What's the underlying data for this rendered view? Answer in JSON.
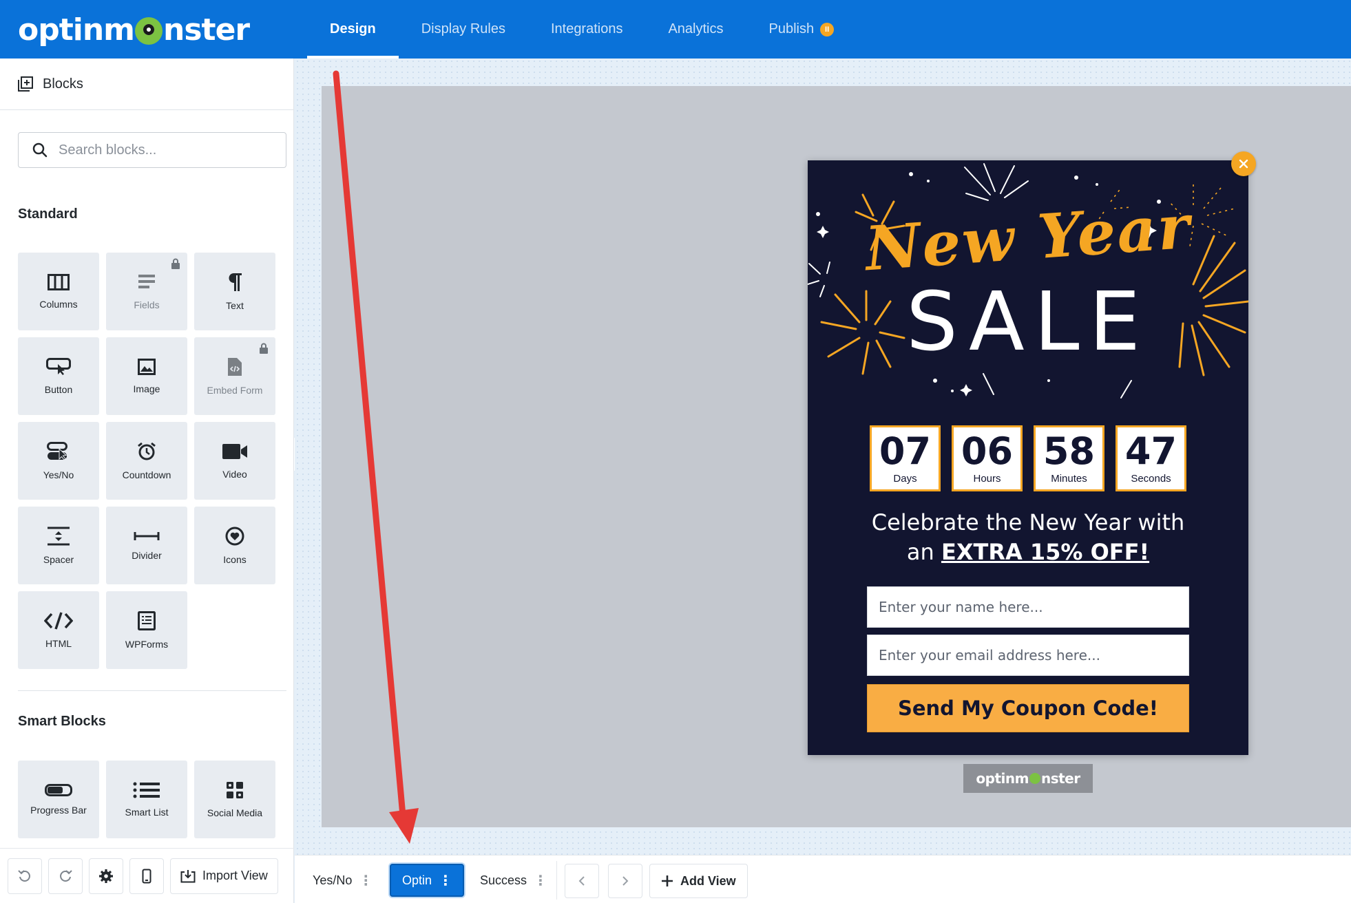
{
  "app": {
    "logo_text_before": "optinm",
    "logo_text_after": "nster"
  },
  "nav": {
    "tabs": [
      {
        "label": "Design"
      },
      {
        "label": "Display Rules"
      },
      {
        "label": "Integrations"
      },
      {
        "label": "Analytics"
      },
      {
        "label": "Publish"
      }
    ],
    "active": "Design"
  },
  "sidebar": {
    "header": "Blocks",
    "search_placeholder": "Search blocks...",
    "standard_title": "Standard",
    "standard_blocks": [
      {
        "label": "Columns",
        "icon": "columns-icon",
        "locked": false
      },
      {
        "label": "Fields",
        "icon": "fields-icon",
        "locked": true
      },
      {
        "label": "Text",
        "icon": "paragraph-icon",
        "locked": false
      },
      {
        "label": "Button",
        "icon": "button-icon",
        "locked": false
      },
      {
        "label": "Image",
        "icon": "image-icon",
        "locked": false
      },
      {
        "label": "Embed Form",
        "icon": "embed-form-icon",
        "locked": true
      },
      {
        "label": "Yes/No",
        "icon": "yes-no-icon",
        "locked": false
      },
      {
        "label": "Countdown",
        "icon": "alarm-clock-icon",
        "locked": false
      },
      {
        "label": "Video",
        "icon": "video-camera-icon",
        "locked": false
      },
      {
        "label": "Spacer",
        "icon": "spacer-icon",
        "locked": false
      },
      {
        "label": "Divider",
        "icon": "divider-icon",
        "locked": false
      },
      {
        "label": "Icons",
        "icon": "heart-circle-icon",
        "locked": false
      },
      {
        "label": "HTML",
        "icon": "code-icon",
        "locked": false
      },
      {
        "label": "WPForms",
        "icon": "wpforms-icon",
        "locked": false
      }
    ],
    "smart_title": "Smart Blocks",
    "smart_blocks": [
      {
        "label": "Progress Bar",
        "icon": "progress-bar-icon"
      },
      {
        "label": "Smart List",
        "icon": "list-icon"
      },
      {
        "label": "Social Media",
        "icon": "social-media-icon"
      }
    ],
    "footer": {
      "import_label": "Import View"
    }
  },
  "popup": {
    "headline_script": "New Year",
    "headline_sale": "SALE",
    "countdown": [
      {
        "value": "07",
        "label": "Days"
      },
      {
        "value": "06",
        "label": "Hours"
      },
      {
        "value": "58",
        "label": "Minutes"
      },
      {
        "value": "47",
        "label": "Seconds"
      }
    ],
    "text_line1": "Celebrate the New Year with",
    "text_line2_prefix": "an ",
    "text_line2_emph": "EXTRA 15% OFF!",
    "name_placeholder": "Enter your name here...",
    "email_placeholder": "Enter your email address here...",
    "button_label": "Send My Coupon Code!",
    "accent_color": "#f5a623",
    "background_color": "#121530",
    "brand_badge_before": "optinm",
    "brand_badge_after": "nster"
  },
  "views": {
    "tabs": [
      {
        "label": "Yes/No"
      },
      {
        "label": "Optin"
      },
      {
        "label": "Success"
      }
    ],
    "active": "Optin",
    "add_view_label": "Add View"
  },
  "colors": {
    "primary": "#0a72d9",
    "annotation_arrow": "#e53935"
  }
}
